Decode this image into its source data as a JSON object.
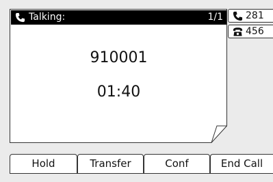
{
  "call": {
    "status": "Talking:",
    "page_indicator": "1/1",
    "number": "910001",
    "duration": "01:40"
  },
  "lines": [
    {
      "label": "281",
      "icon": "handset-icon"
    },
    {
      "label": "456",
      "icon": "desk-phone-icon"
    }
  ],
  "softkeys": [
    {
      "label": "Hold"
    },
    {
      "label": "Transfer"
    },
    {
      "label": "Conf"
    },
    {
      "label": "End Call"
    }
  ],
  "colors": {
    "background": "#ebebeb",
    "panel": "#ffffff",
    "titlebar": "#000000",
    "text": "#111111"
  }
}
